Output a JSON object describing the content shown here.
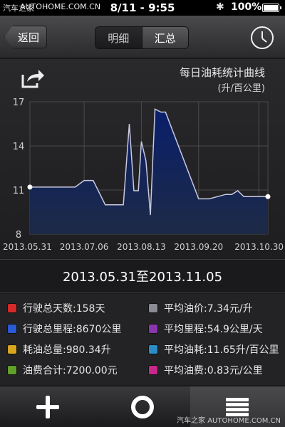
{
  "status_bar": {
    "carrier": "汽车之家",
    "watermark": "AUTOHOME.COM.CN",
    "time": "8/11 - 9:55",
    "battery": "100%"
  },
  "nav": {
    "back_label": "返回",
    "tabs": [
      "明细",
      "汇总"
    ],
    "selected_tab": "汇总"
  },
  "chart_panel": {
    "title": "每日油耗统计曲线",
    "unit": "(升/百公里)"
  },
  "chart_data": {
    "type": "area",
    "title": "每日油耗统计曲线",
    "ylabel": "(升/百公里)",
    "ylim": [
      8,
      17
    ],
    "yticks": [
      8,
      11,
      14,
      17
    ],
    "xticks": [
      "2013.05.31",
      "2013.07.06",
      "2013.08.13",
      "2013.09.20",
      "2013.10.30"
    ],
    "x": [
      "2013.05.31",
      "2013.06.30",
      "2013.07.06",
      "2013.07.12",
      "2013.07.20",
      "2013.08.01",
      "2013.08.05",
      "2013.08.08",
      "2013.08.11",
      "2013.08.13",
      "2013.08.16",
      "2013.08.19",
      "2013.08.22",
      "2013.08.26",
      "2013.08.29",
      "2013.09.20",
      "2013.09.23",
      "2013.09.27",
      "2013.10.08",
      "2013.10.12",
      "2013.10.16",
      "2013.10.20",
      "2013.10.30",
      "2013.11.05"
    ],
    "values": [
      11.2,
      11.2,
      11.65,
      11.65,
      10.0,
      10.0,
      15.5,
      10.95,
      10.95,
      14.3,
      13.0,
      9.3,
      16.5,
      16.3,
      16.3,
      10.4,
      10.4,
      10.4,
      10.7,
      10.7,
      10.95,
      10.55,
      10.55,
      10.55
    ],
    "colors": {
      "fill_top": "#0a1f6b",
      "fill_bottom": "#1d2a46",
      "line": "#c8c8e0"
    }
  },
  "date_range": "2013.05.31至2013.11.05",
  "stats": [
    {
      "label": "行驶总天数:158天",
      "color": "#d42a2a"
    },
    {
      "label": "平均油价:7.34元/升",
      "color": "#8c8c96"
    },
    {
      "label": "行驶总里程:8670公里",
      "color": "#2a5bd4"
    },
    {
      "label": "平均里程:54.9公里/天",
      "color": "#8a35b0"
    },
    {
      "label": "耗油总量:980.34升",
      "color": "#d8a51e"
    },
    {
      "label": "平均油耗:11.65升/百公里",
      "color": "#2a8cc8"
    },
    {
      "label": "油费合计:7200.00元",
      "color": "#5fa12a"
    },
    {
      "label": "平均油费:0.83元/公里",
      "color": "#c8288c"
    }
  ],
  "tabbar": {
    "icons": [
      "plus-icon",
      "gauge-icon",
      "list-icon"
    ],
    "watermark": "汽车之家 AUTOHOME.COM.CN"
  }
}
